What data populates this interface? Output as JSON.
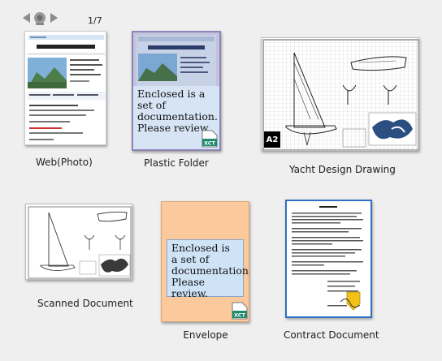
{
  "pager": {
    "current": "1/7"
  },
  "items": [
    {
      "label": "Web(Photo)"
    },
    {
      "label": "Plastic Folder",
      "note": "Enclosed is a set of documentation. Please review.",
      "badge": "XCT"
    },
    {
      "label": "Yacht Design Drawing",
      "size_badge": "A2"
    },
    {
      "label": "Scanned Document"
    },
    {
      "label": "Envelope",
      "note": "Enclosed is a set of documentation. Please review.",
      "badge": "XCT"
    },
    {
      "label": "Contract Document"
    }
  ],
  "colors": {
    "background": "#efefef",
    "folder_frame": "#8a86b8",
    "envelope": "#fbc99c",
    "note_fill": "#cfe3f7",
    "selected_border": "#2f6fbf"
  },
  "icons": [
    "nav-left-arrow-icon",
    "camera-icon",
    "nav-right-arrow-icon",
    "xct-file-icon"
  ]
}
